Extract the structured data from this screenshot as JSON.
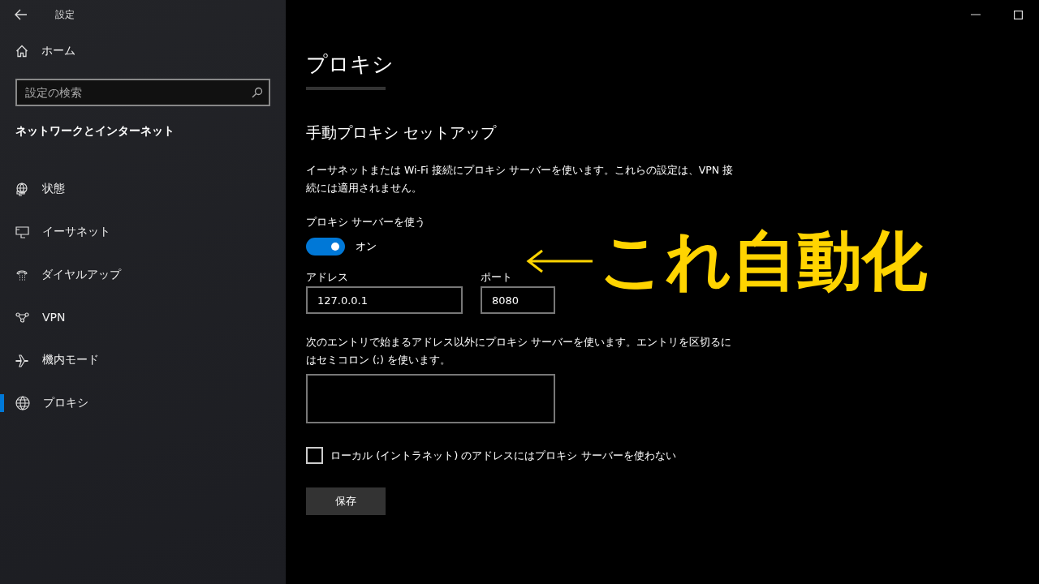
{
  "window": {
    "title": "設定"
  },
  "sidebar": {
    "home": "ホーム",
    "search": {
      "placeholder": "設定の検索"
    },
    "section": "ネットワークとインターネット",
    "items": [
      {
        "label": "状態",
        "selected": false
      },
      {
        "label": "イーサネット",
        "selected": false
      },
      {
        "label": "ダイヤルアップ",
        "selected": false
      },
      {
        "label": "VPN",
        "selected": false
      },
      {
        "label": "機内モード",
        "selected": false
      },
      {
        "label": "プロキシ",
        "selected": true
      }
    ]
  },
  "main": {
    "title": "プロキシ",
    "section": "手動プロキシ セットアップ",
    "description": "イーサネットまたは Wi-Fi 接続にプロキシ サーバーを使います。これらの設定は、VPN 接続には適用されません。",
    "toggle": {
      "label": "プロキシ サーバーを使う",
      "on": true,
      "state_text": "オン"
    },
    "address": {
      "label": "アドレス",
      "value": "127.0.0.1"
    },
    "port": {
      "label": "ポート",
      "value": "8080"
    },
    "exceptions": {
      "description": "次のエントリで始まるアドレス以外にプロキシ サーバーを使います。エントリを区切るにはセミコロン (;) を使います。"
    },
    "local": {
      "label": "ローカル (イントラネット) のアドレスにはプロキシ サーバーを使わない",
      "checked": false
    },
    "save": "保存"
  },
  "annotation": {
    "text": "これ自動化"
  }
}
